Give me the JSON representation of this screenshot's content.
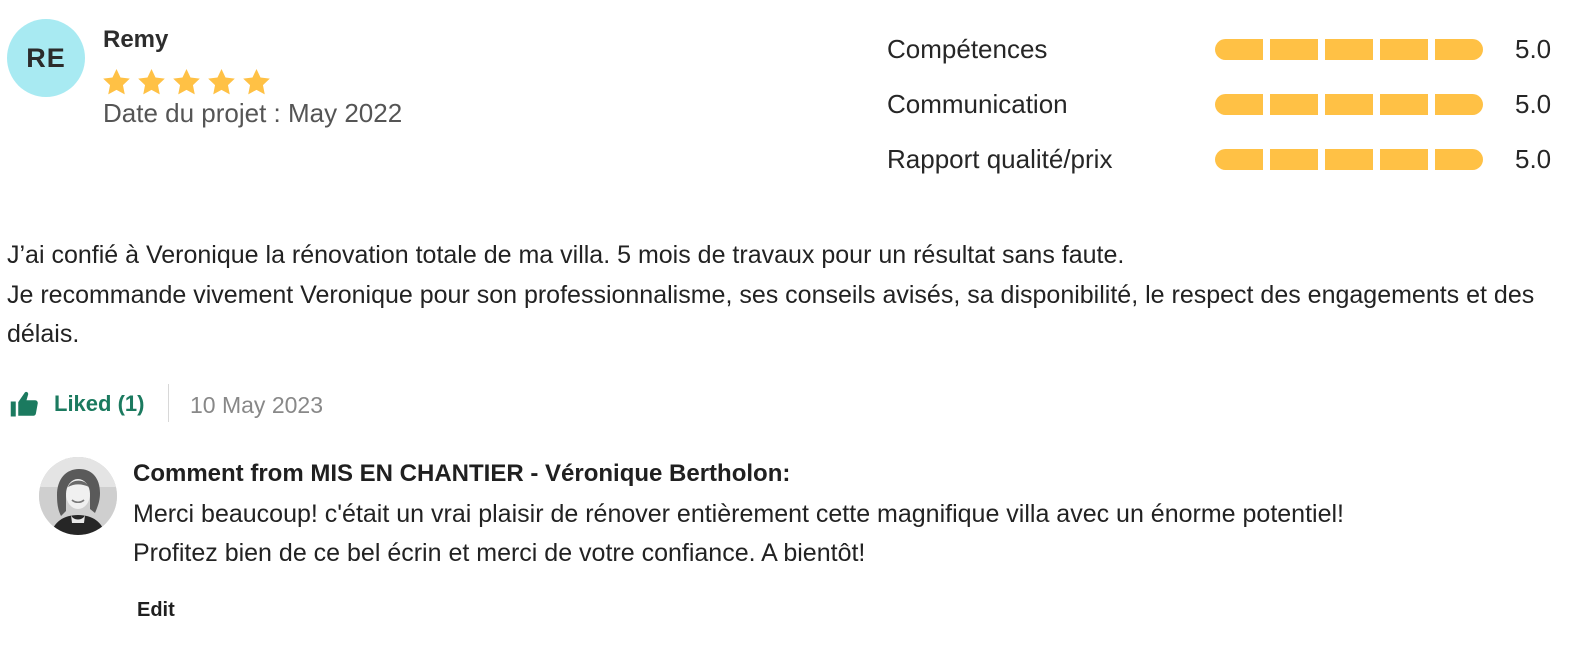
{
  "review": {
    "avatar_initials": "RE",
    "reviewer_name": "Remy",
    "overall_rating": 5,
    "project_date": "Date du projet : May 2022",
    "star_color": "#ffc145",
    "ratings": [
      {
        "label": "Compétences",
        "value": "5.0",
        "score": 5
      },
      {
        "label": "Communication",
        "value": "5.0",
        "score": 5
      },
      {
        "label": "Rapport qualité/prix",
        "value": "5.0",
        "score": 5
      }
    ],
    "text_lines": [
      "J’ai confié à Veronique la rénovation totale de ma villa. 5 mois de travaux pour un résultat sans faute.",
      "Je recommande vivement Veronique pour son professionnalisme, ses conseils avisés, sa disponibilité, le respect des engagements et des délais."
    ]
  },
  "actions": {
    "like_label": "Liked (1)",
    "like_icon": "thumbs-up-icon",
    "accent_color": "#1b7a5f",
    "review_date": "10 May 2023"
  },
  "comment": {
    "header": "Comment from MIS EN CHANTIER - Véronique Bertholon:",
    "body_lines": [
      "Merci beaucoup! c'était un vrai plaisir de rénover entièrement cette magnifique villa avec un énorme potentiel!",
      "Profitez bien de ce bel écrin et merci de votre confiance. A bientôt!"
    ],
    "edit_label": "Edit"
  }
}
